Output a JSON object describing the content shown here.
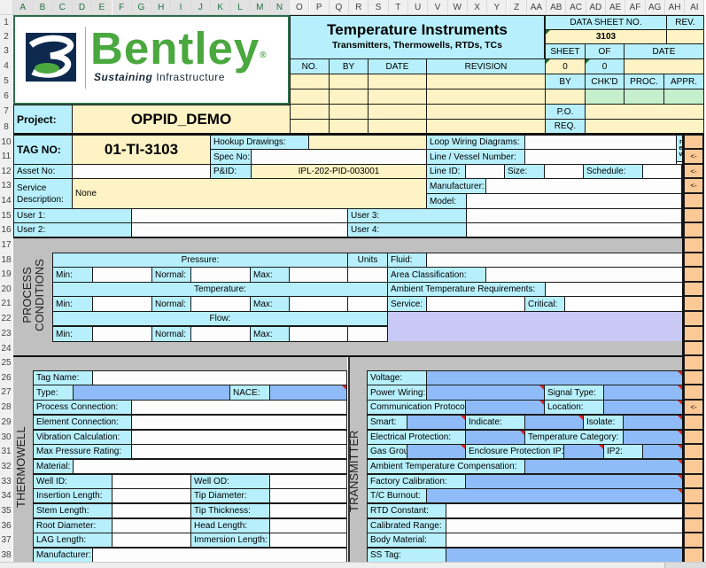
{
  "columns": [
    "A",
    "B",
    "C",
    "D",
    "E",
    "F",
    "G",
    "H",
    "I",
    "J",
    "K",
    "L",
    "M",
    "N",
    "O",
    "P",
    "Q",
    "R",
    "S",
    "T",
    "U",
    "V",
    "W",
    "X",
    "Y",
    "Z",
    "AA",
    "AB",
    "AC",
    "AD",
    "AE",
    "AF",
    "AG",
    "AH",
    "AI"
  ],
  "rows": [
    "1",
    "2",
    "3",
    "4",
    "5",
    "6",
    "7",
    "8",
    "10",
    "11",
    "12",
    "13",
    "14",
    "15",
    "16",
    "17",
    "18",
    "19",
    "20",
    "21",
    "22",
    "23",
    "24",
    "25",
    "26",
    "27",
    "28",
    "29",
    "30",
    "31",
    "32",
    "33",
    "34",
    "35",
    "36",
    "37",
    "38"
  ],
  "logo": {
    "brand": "Bentley",
    "registered": "®",
    "tagline_bold": "Sustaining",
    "tagline": "Infrastructure"
  },
  "header": {
    "title": "Temperature Instruments",
    "subtitle": "Transmitters, Thermowells, RTDs, TCs",
    "data_sheet_label": "DATA SHEET NO.",
    "rev_label": "REV.",
    "data_sheet_no": "3103",
    "rev_value": "",
    "sheet_label": "SHEET",
    "of_label": "OF",
    "date_label": "DATE",
    "sheet_value": "0",
    "of_value": "0",
    "rev_table_headers": [
      "NO.",
      "BY",
      "DATE",
      "REVISION"
    ],
    "approval_headers": [
      "BY",
      "CHK'D",
      "PROC.",
      "APPR."
    ],
    "po_label": "P.O.",
    "req_label": "REQ."
  },
  "project": {
    "label": "Project:",
    "value": "OPPID_DEMO"
  },
  "tag": {
    "label": "TAG NO:",
    "value": "01-TI-3103"
  },
  "general": {
    "hookup_drawings": "Hookup Drawings:",
    "spec_no": "Spec No:",
    "pid_label": "P&ID:",
    "pid_value": "IPL-202-PID-003001",
    "asset_no": "Asset No:",
    "service_label_1": "Service",
    "service_label_2": "Description:",
    "service_value": "None",
    "loop_wiring": "Loop Wiring Diagrams:",
    "line_vessel": "Line / Vessel Number:",
    "line_id": "Line ID:",
    "size": "Size:",
    "schedule": "Schedule:",
    "manufacturer": "Manufacturer:",
    "model": "Model:",
    "user1": "User 1:",
    "user2": "User 2:",
    "user3": "User 3:",
    "user4": "User 4:",
    "rev_button": "r e v",
    "arrow": "<-"
  },
  "process": {
    "section_title_1": "PROCESS",
    "section_title_2": "CONDITIONS",
    "pressure": "Pressure:",
    "temperature": "Temperature:",
    "flow": "Flow:",
    "units": "Units",
    "min": "Min:",
    "normal": "Normal:",
    "max": "Max:",
    "fluid": "Fluid:",
    "area_classification": "Area Classification:",
    "ambient_temp_req": "Ambient Temperature Requirements:",
    "service": "Service:",
    "critical": "Critical:"
  },
  "thermowell": {
    "section_title": "THERMOWELL",
    "tag_name": "Tag Name:",
    "type": "Type:",
    "nace": "NACE:",
    "process_connection": "Process Connection:",
    "element_connection": "Element Connection:",
    "vibration_calculation": "Vibration Calculation:",
    "max_pressure_rating": "Max Pressure Rating:",
    "material": "Material:",
    "well_id": "Well ID:",
    "well_od": "Well OD:",
    "insertion_length": "Insertion Length:",
    "tip_diameter": "Tip Diameter:",
    "stem_length": "Stem Length:",
    "tip_thickness": "Tip Thickness:",
    "root_diameter": "Root Diameter:",
    "head_length": "Head Length:",
    "lag_length": "LAG Length:",
    "immersion_length": "Immersion Length:",
    "manufacturer": "Manufacturer:"
  },
  "transmitter": {
    "section_title": "TRANSMITTER",
    "voltage": "Voltage:",
    "power_wiring": "Power Wiring:",
    "signal_type": "Signal Type:",
    "communication_protocol": "Communication Protocol:",
    "location": "Location:",
    "smart": "Smart:",
    "indicate": "Indicate:",
    "isolate": "Isolate:",
    "electrical_protection": "Electrical Protection:",
    "temperature_category": "Temperature Category:",
    "gas_group": "Gas Group:",
    "enclosure_ip1": "Enclosure Protection IP1",
    "ip2": "IP2:",
    "ambient_temp_comp": "Ambient Temperature Compensation:",
    "factory_calibration": "Factory Calibration:",
    "tc_burnout": "T/C Burnout:",
    "rtd_constant": "RTD Constant:",
    "calibrated_range": "Calibrated Range:",
    "body_material": "Body Material:",
    "ss_tag": "SS Tag:"
  },
  "colors": {
    "cyan_label": "#b7f0fc",
    "yellow_input": "#fdf3c4",
    "blue_select": "#8fbcf8",
    "green": "#c6efce",
    "orange": "#fbc996",
    "lavender": "#c9c9f5",
    "grey_section": "#c0c0c0",
    "brand_green": "#4aa83f",
    "brand_navy": "#0d2a4e"
  }
}
